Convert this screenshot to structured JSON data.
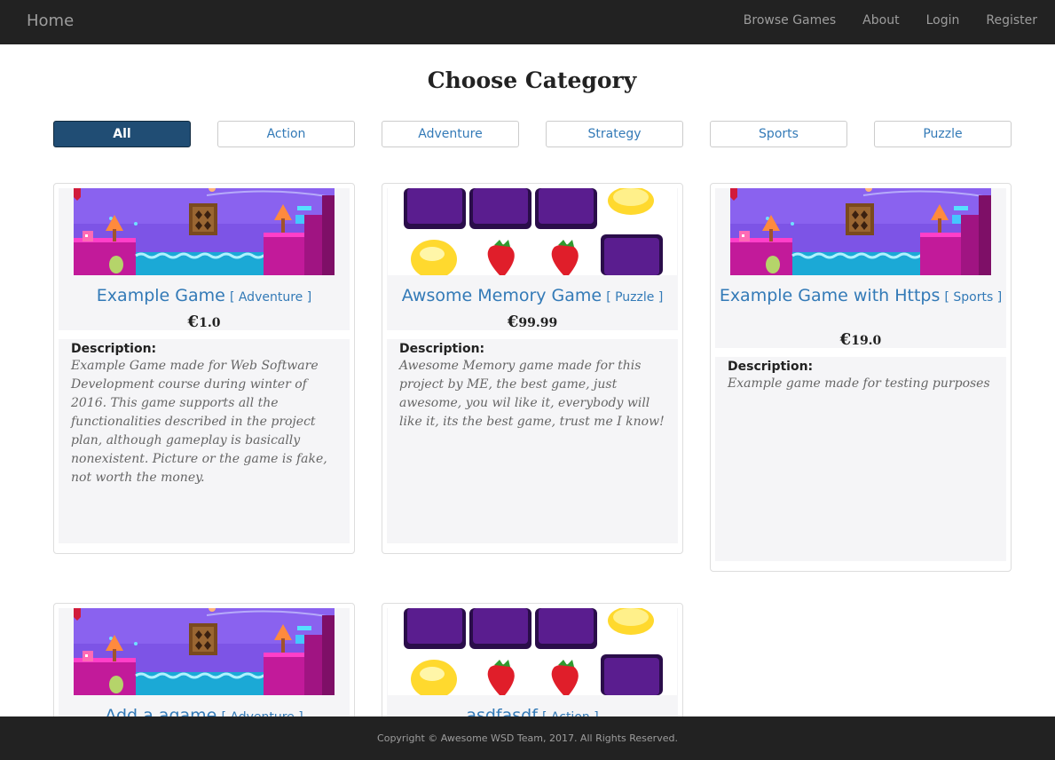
{
  "nav": {
    "brand": "Home",
    "links": [
      "Browse Games",
      "About",
      "Login",
      "Register"
    ]
  },
  "page_title": "Choose Category",
  "categories": [
    "All",
    "Action",
    "Adventure",
    "Strategy",
    "Sports",
    "Puzzle"
  ],
  "active_category": "All",
  "description_label": "Description:",
  "currency": "€",
  "games": [
    {
      "name": "Example Game",
      "category": "[ Adventure ]",
      "price": "1.0",
      "description": "Example Game made for Web Software Development course during winter of 2016. This game supports all the functionalities described in the project plan, although gameplay is basically nonexistent. Picture or the game is fake, not worth the money.",
      "thumbnail": "platformer-thumbnail"
    },
    {
      "name": "Awsome Memory Game",
      "category": "[ Puzzle ]",
      "price": "99.99",
      "description": "Awesome Memory game made for this project by ME, the best game, just awesome, you wil like it, everybody will like it, its the best game, trust me I know!",
      "thumbnail": "memory-thumbnail"
    },
    {
      "name": "Example Game with Https",
      "category": "[ Sports ]",
      "price": "19.0",
      "description": "Example game made for testing purposes",
      "thumbnail": "platformer-thumbnail"
    },
    {
      "name": "Add a agame",
      "category": "[ Adventure ]",
      "thumbnail": "platformer-thumbnail"
    },
    {
      "name": "asdfasdf",
      "category": "[ Action ]",
      "thumbnail": "memory-thumbnail"
    }
  ],
  "footer": "Copyright © Awesome WSD Team, 2017. All Rights Reserved.",
  "colors": {
    "navbar": "#222222",
    "link": "#337ab7",
    "active_button": "#204d74",
    "panel": "#f5f5f7"
  }
}
